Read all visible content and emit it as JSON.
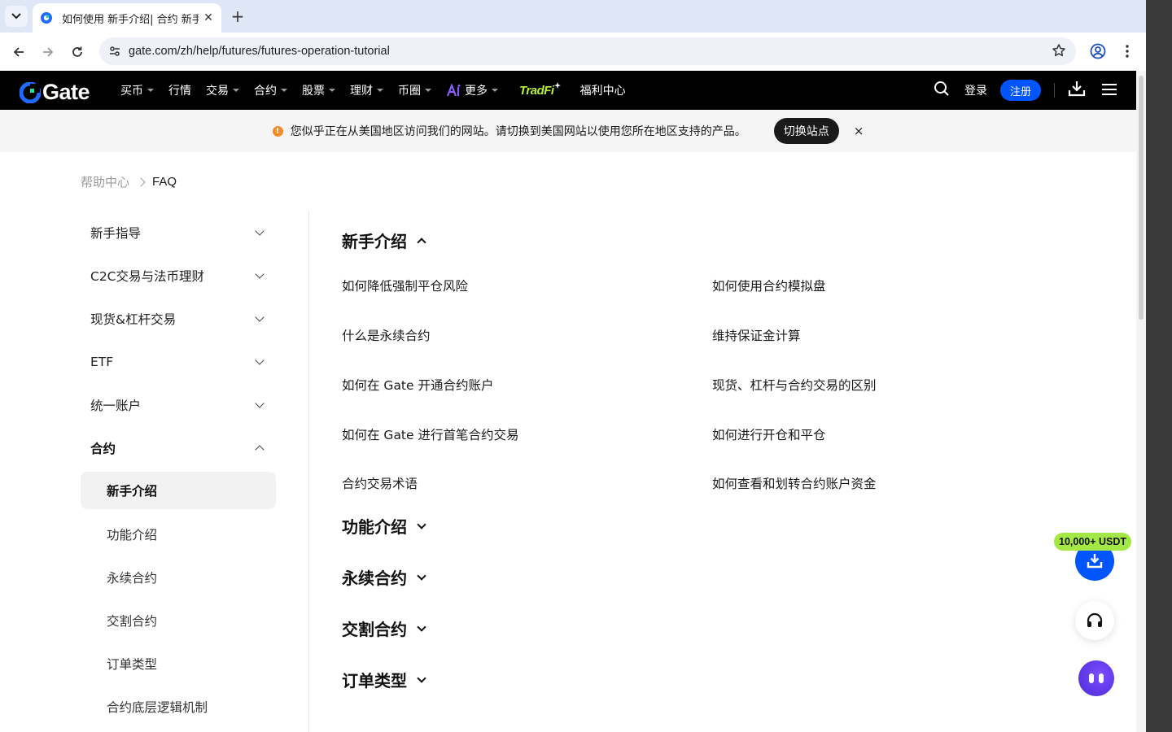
{
  "browser": {
    "tab_title": "如何使用 新手介绍| 合约 新手",
    "url": "gate.com/zh/help/futures/futures-operation-tutorial"
  },
  "nav": {
    "brand": "Gate",
    "items": [
      {
        "label": "买币",
        "caret": true
      },
      {
        "label": "行情",
        "caret": false
      },
      {
        "label": "交易",
        "caret": true
      },
      {
        "label": "合约",
        "caret": true
      },
      {
        "label": "股票",
        "caret": true
      },
      {
        "label": "理财",
        "caret": true
      },
      {
        "label": "币圈",
        "caret": true
      },
      {
        "label": "更多",
        "caret": true
      }
    ],
    "tradfi": "TradFi",
    "welfare": "福利中心",
    "login": "登录",
    "register": "注册"
  },
  "notice": {
    "text": "您似乎正在从美国地区访问我们的网站。请切换到美国网站以使用您所在地区支持的产品。",
    "switch_label": "切换站点",
    "close": "×"
  },
  "breadcrumb": {
    "parent": "帮助中心",
    "current": "FAQ"
  },
  "sidebar": {
    "categories": [
      {
        "label": "新手指导"
      },
      {
        "label": "C2C交易与法币理财"
      },
      {
        "label": "现货&杠杆交易"
      },
      {
        "label": "ETF"
      },
      {
        "label": "统一账户"
      },
      {
        "label": "合约"
      }
    ],
    "sub_items": [
      "新手介绍",
      "功能介绍",
      "永续合约",
      "交割合约",
      "订单类型",
      "合约底层逻辑机制"
    ]
  },
  "content": {
    "expanded_section": "新手介绍",
    "faq_left": [
      "如何降低强制平仓风险",
      "什么是永续合约",
      "如何在 Gate 开通合约账户",
      "如何在 Gate 进行首笔合约交易",
      "合约交易术语"
    ],
    "faq_right": [
      "如何使用合约模拟盘",
      "维持保证金计算",
      "现货、杠杆与合约交易的区别",
      "如何进行开仓和平仓",
      "如何查看和划转合约账户资金"
    ],
    "collapsed_sections": [
      "功能介绍",
      "永续合约",
      "交割合约",
      "订单类型"
    ]
  },
  "floating": {
    "badge": "10,000+ USDT"
  },
  "colors": {
    "brand_blue": "#0055ff",
    "badge_green": "#a4e845",
    "tradfi_green": "#b7f23a",
    "warning_orange": "#f28c28"
  }
}
